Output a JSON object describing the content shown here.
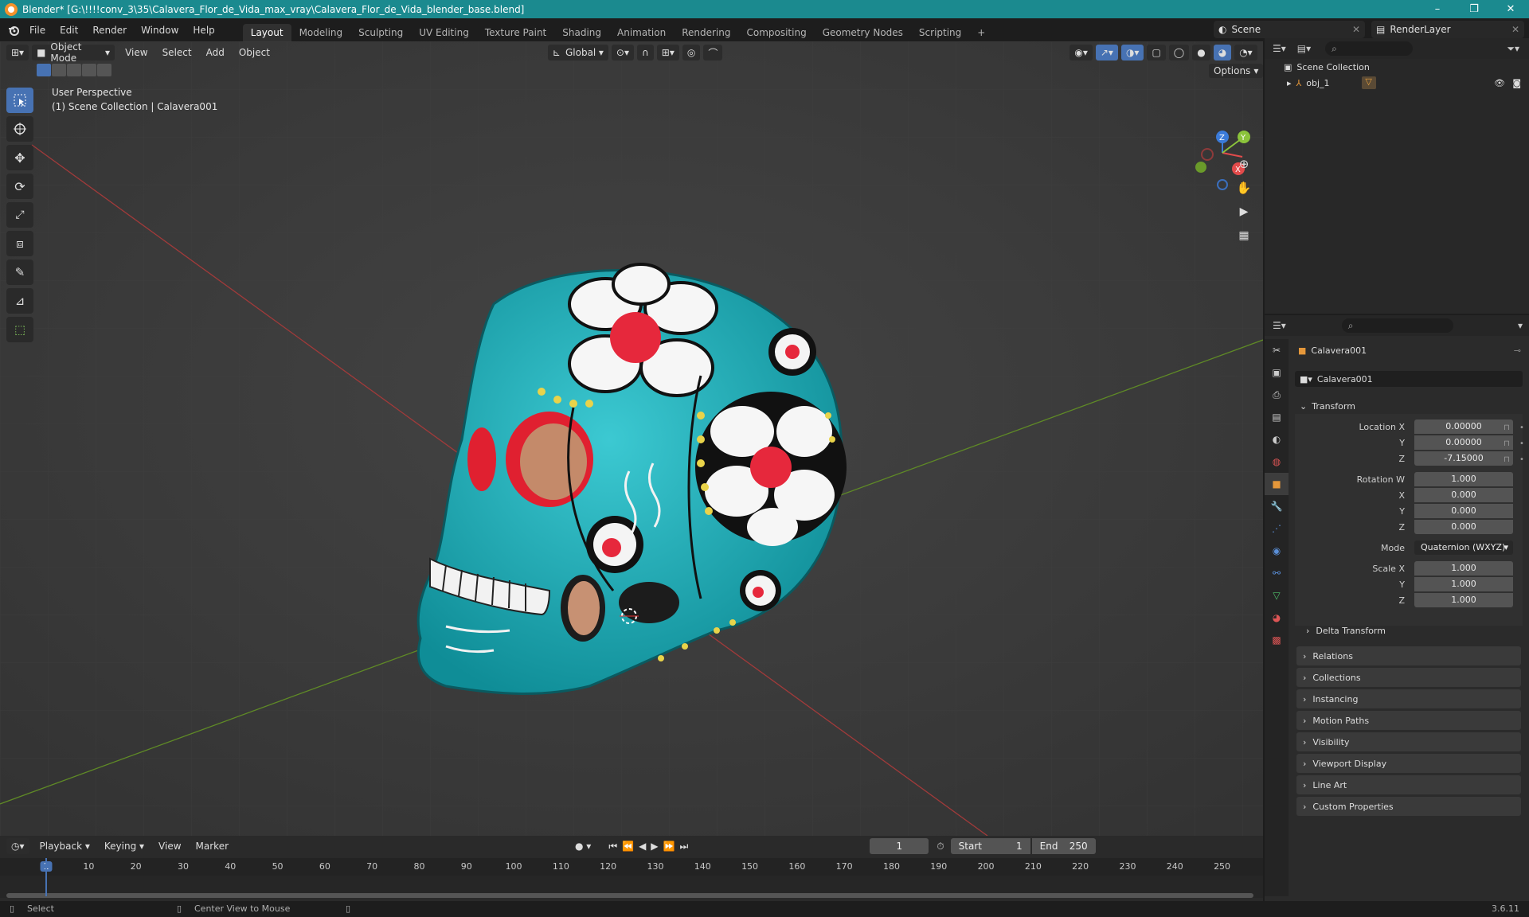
{
  "window": {
    "title": "Blender* [G:\\!!!!conv_3\\35\\Calavera_Flor_de_Vida_max_vray\\Calavera_Flor_de_Vida_blender_base.blend]",
    "minimize": "–",
    "maximize": "❐",
    "close": "✕"
  },
  "menubar": {
    "menus": [
      "File",
      "Edit",
      "Render",
      "Window",
      "Help"
    ],
    "workspaces": [
      "Layout",
      "Modeling",
      "Sculpting",
      "UV Editing",
      "Texture Paint",
      "Shading",
      "Animation",
      "Rendering",
      "Compositing",
      "Geometry Nodes",
      "Scripting"
    ],
    "active_workspace": "Layout",
    "add_workspace": "+",
    "scene": "Scene",
    "view_layer": "RenderLayer"
  },
  "viewport": {
    "mode": "Object Mode",
    "menus": [
      "View",
      "Select",
      "Add",
      "Object"
    ],
    "orientation": "Global",
    "options_label": "Options",
    "overlay_line1": "User Perspective",
    "overlay_line2": "(1) Scene Collection | Calavera001",
    "gizmo": {
      "z": "Z",
      "y": "Y",
      "x": "X"
    }
  },
  "outliner": {
    "root": "Scene Collection",
    "items": [
      {
        "name": "obj_1"
      }
    ]
  },
  "properties": {
    "object_name": "Calavera001",
    "datablock_name": "Calavera001",
    "transform_header": "Transform",
    "location": {
      "label_x": "Location X",
      "label_y": "Y",
      "label_z": "Z",
      "x": "0.00000",
      "y": "0.00000",
      "z": "-7.15000"
    },
    "rotation": {
      "label_w": "Rotation W",
      "label_x": "X",
      "label_y": "Y",
      "label_z": "Z",
      "w": "1.000",
      "x": "0.000",
      "y": "0.000",
      "z": "0.000"
    },
    "mode_label": "Mode",
    "mode_value": "Quaternion (WXYZ)",
    "scale": {
      "label_x": "Scale X",
      "label_y": "Y",
      "label_z": "Z",
      "x": "1.000",
      "y": "1.000",
      "z": "1.000"
    },
    "delta_transform": "Delta Transform",
    "panels": [
      "Relations",
      "Collections",
      "Instancing",
      "Motion Paths",
      "Visibility",
      "Viewport Display",
      "Line Art",
      "Custom Properties"
    ]
  },
  "timeline": {
    "menus": [
      "Playback",
      "Keying",
      "View",
      "Marker"
    ],
    "current_frame": "1",
    "start_label": "Start",
    "start": "1",
    "end_label": "End",
    "end": "250",
    "ruler": [
      "1",
      "10",
      "20",
      "30",
      "40",
      "50",
      "60",
      "70",
      "80",
      "90",
      "100",
      "110",
      "120",
      "130",
      "140",
      "150",
      "160",
      "170",
      "180",
      "190",
      "200",
      "210",
      "220",
      "230",
      "240",
      "250"
    ]
  },
  "statusbar": {
    "left": "Select",
    "middle": "Center View to Mouse",
    "version": "3.6.11"
  },
  "colors": {
    "titlebar": "#1b8a8f",
    "accent": "#4772b3",
    "skull_base": "#19a8b3",
    "flower_center": "#e6283c",
    "axis_x": "#b83a3a",
    "axis_y": "#6e9a2a"
  }
}
